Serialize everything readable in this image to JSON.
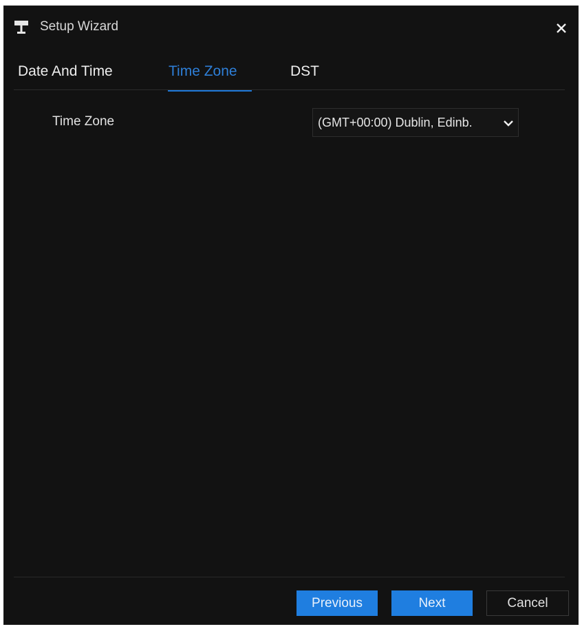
{
  "window": {
    "title": "Setup Wizard",
    "icon": "wizard-signpost-icon",
    "close_icon": "close-icon"
  },
  "tabs": [
    {
      "label": "Date And Time",
      "active": false
    },
    {
      "label": "Time Zone",
      "active": true
    },
    {
      "label": "DST",
      "active": false
    }
  ],
  "form": {
    "time_zone_label": "Time Zone",
    "time_zone_value": "(GMT+00:00) Dublin, Edinb."
  },
  "buttons": {
    "previous": "Previous",
    "next": "Next",
    "cancel": "Cancel"
  },
  "colors": {
    "background": "#121212",
    "accent": "#1f7ee0",
    "active_tab": "#2e7fd8",
    "text": "#e2e2e2"
  }
}
